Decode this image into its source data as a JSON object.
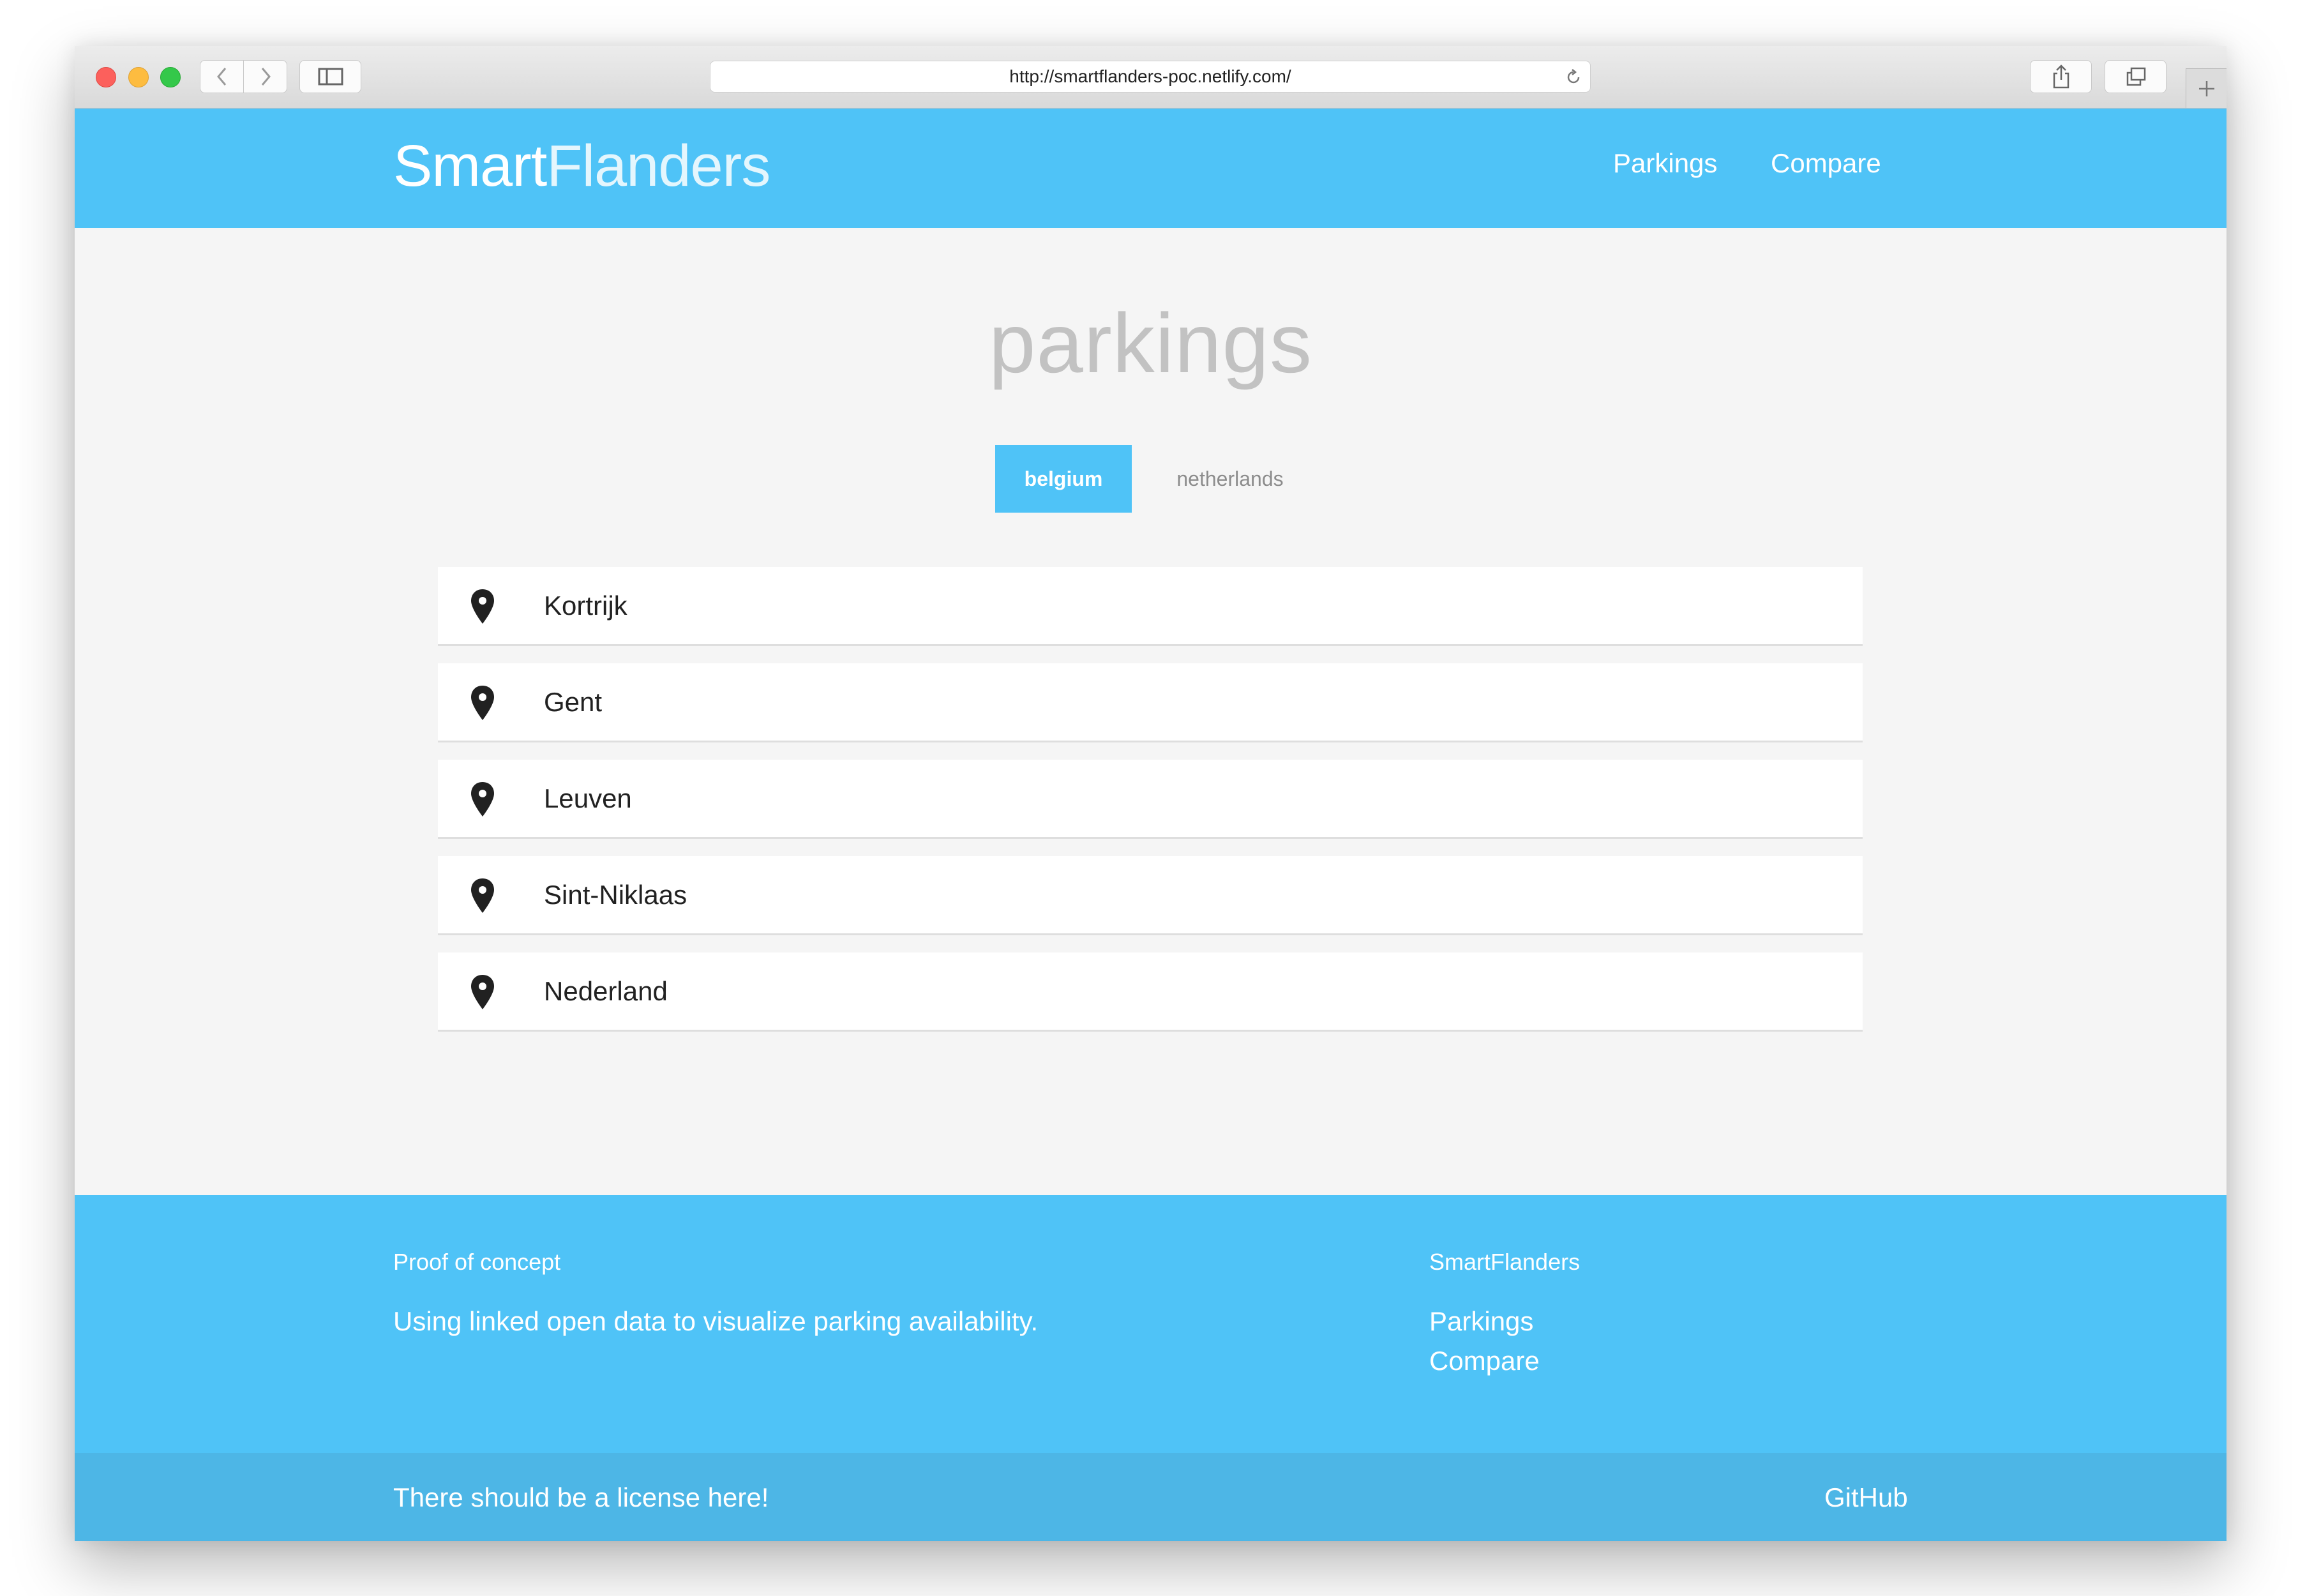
{
  "browser": {
    "url": "http://smartflanders-poc.netlify.com/"
  },
  "header": {
    "brand_part1": "Smart",
    "brand_part2": "Flanders",
    "nav": [
      "Parkings",
      "Compare"
    ]
  },
  "main": {
    "title": "parkings",
    "tabs": [
      {
        "label": "belgium",
        "active": true
      },
      {
        "label": "netherlands",
        "active": false
      }
    ],
    "items": [
      "Kortrijk",
      "Gent",
      "Leuven",
      "Sint-Niklaas",
      "Nederland"
    ],
    "item_icon": "map-pin-icon"
  },
  "footer": {
    "left_heading": "Proof of concept",
    "left_text": "Using linked open data to visualize parking availability.",
    "right_heading": "SmartFlanders",
    "links": [
      "Parkings",
      "Compare"
    ],
    "license": "There should be a license here!",
    "github": "GitHub"
  },
  "colors": {
    "accent": "#4fc3f7",
    "bottom_bar": "#4db6e6",
    "background": "#f5f5f5"
  }
}
